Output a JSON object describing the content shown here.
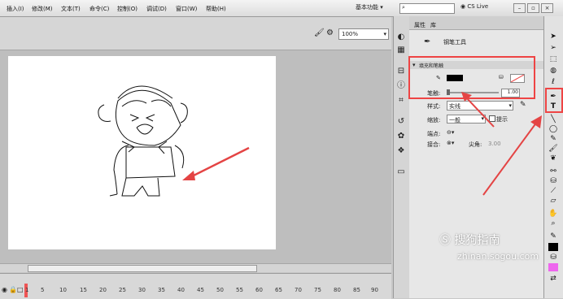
{
  "menu": [
    "插入(I)",
    "修改(M)",
    "文本(T)",
    "命令(C)",
    "控制(O)",
    "调试(D)",
    "窗口(W)",
    "帮助(H)"
  ],
  "workspace": "基本功能",
  "cslive": "CS Live",
  "zoom": "100%",
  "props": {
    "tabs": [
      "属性",
      "库"
    ],
    "tool_name": "钢笔工具",
    "section": "填充和笔触",
    "stroke_label": "笔触:",
    "stroke_value": "1.00",
    "style_label": "样式:",
    "style_value": "实线",
    "scale_label": "缩放:",
    "scale_value": "一般",
    "hint_label": "提示",
    "cap_label": "端点:",
    "join_label": "接合:",
    "miter_label": "尖角:",
    "miter_value": "3.00"
  },
  "timeline_frames": [
    "1",
    "5",
    "10",
    "15",
    "20",
    "25",
    "30",
    "35",
    "40",
    "45",
    "50",
    "55",
    "60",
    "65",
    "70",
    "75",
    "80",
    "85",
    "90"
  ],
  "watermark": {
    "text": "搜狗指南",
    "url": "zhinan.sogou.com"
  },
  "colors": {
    "highlight": "#e44444",
    "stroke": "#000000",
    "fill_swatch": "#ee66ee"
  }
}
